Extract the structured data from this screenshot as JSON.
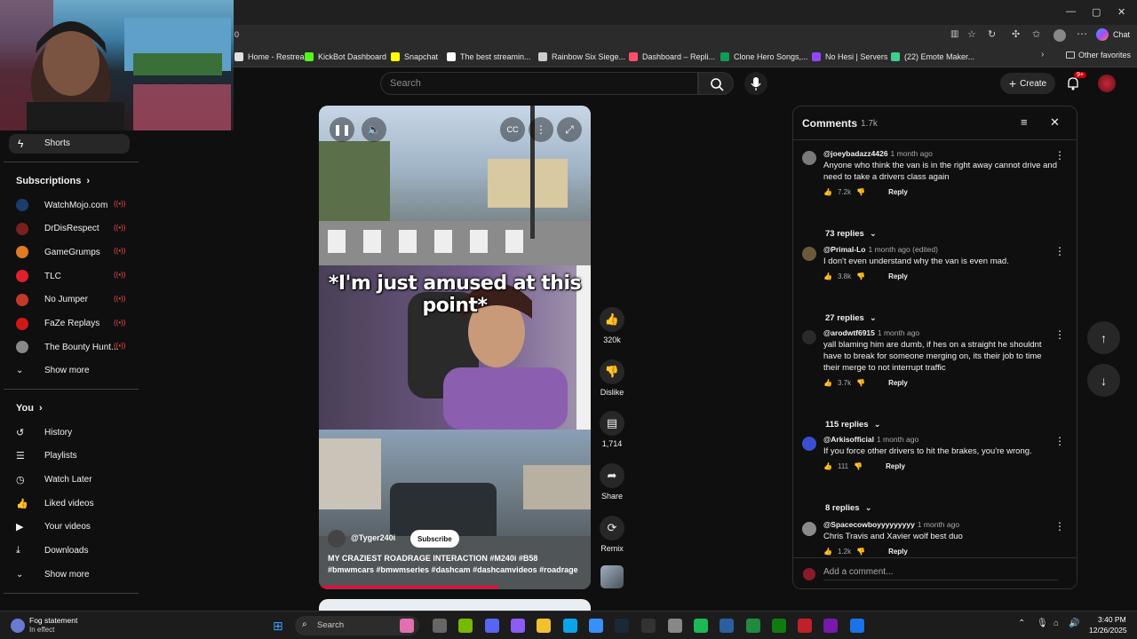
{
  "browser": {
    "address": "0",
    "chat_label": "Chat",
    "other_favorites": "Other favorites",
    "bookmarks": [
      {
        "label": "Home - Restream",
        "color": "#e0e0e0"
      },
      {
        "label": "KickBot Dashboard",
        "color": "#53fc18"
      },
      {
        "label": "Snapchat",
        "color": "#fffc00"
      },
      {
        "label": "The best streamin...",
        "color": "#ffffff"
      },
      {
        "label": "Rainbow Six Siege...",
        "color": "#cccccc"
      },
      {
        "label": "Dashboard – Repli...",
        "color": "#ff4e6a"
      },
      {
        "label": "Clone Hero Songs,...",
        "color": "#0f9d58"
      },
      {
        "label": "No Hesi | Servers",
        "color": "#9146ff"
      },
      {
        "label": "(22) Emote Maker...",
        "color": "#3ecf8e"
      }
    ]
  },
  "header": {
    "search_placeholder": "Search",
    "create_label": "Create",
    "notif_badge": "9+"
  },
  "sidebar": {
    "shorts_label": "Shorts",
    "subscriptions_label": "Subscriptions",
    "channels": [
      {
        "name": "WatchMojo.com",
        "color": "#1a3d6e"
      },
      {
        "name": "DrDisRespect",
        "color": "#7a1f1f"
      },
      {
        "name": "GameGrumps",
        "color": "#e07b20"
      },
      {
        "name": "TLC",
        "color": "#e0202a"
      },
      {
        "name": "No Jumper",
        "color": "#c0392b"
      },
      {
        "name": "FaZe Replays",
        "color": "#d01818"
      },
      {
        "name": "The Bounty Hunt...",
        "color": "#888888"
      }
    ],
    "show_more": "Show more",
    "you_label": "You",
    "you_items": [
      {
        "label": "History",
        "icon": "history-icon"
      },
      {
        "label": "Playlists",
        "icon": "playlists-icon"
      },
      {
        "label": "Watch Later",
        "icon": "watch-later-icon"
      },
      {
        "label": "Liked videos",
        "icon": "liked-icon"
      },
      {
        "label": "Your videos",
        "icon": "your-videos-icon"
      },
      {
        "label": "Downloads",
        "icon": "downloads-icon"
      }
    ],
    "show_more_2": "Show more"
  },
  "video": {
    "caption": "*I'm just amused at this point*",
    "channel": "@Tyger240i",
    "subscribe_label": "Subscribe",
    "title": "MY CRAZIEST ROADRAGE INTERACTION #M240i #B58 #bmwmcars #bmwmseries #dashcam #dashcamvideos #roadrage",
    "progress": 0.66
  },
  "actions": {
    "likes": "320k",
    "dislike": "Dislike",
    "comments": "1,714",
    "share": "Share",
    "remix": "Remix"
  },
  "comments": {
    "title": "Comments",
    "count": "1.7k",
    "add_placeholder": "Add a comment...",
    "reply_label": "Reply",
    "items": [
      {
        "author": "@joeybadazz4426",
        "time": "1 month ago",
        "text": "Anyone who think the van is in the right away cannot drive and need to take a drivers class again",
        "likes": "7.2k",
        "replies": "73 replies",
        "color": "#7a7a7a"
      },
      {
        "author": "@Primal-Lo",
        "time": "1 month ago (edited)",
        "text": "I don't even understand why the van is even mad.",
        "likes": "3.8k",
        "replies": "27 replies",
        "color": "#6b5a3a"
      },
      {
        "author": "@arodwtf6915",
        "time": "1 month ago",
        "text": "yall blaming him are dumb, if hes on a straight he shouldnt have to break for someone merging on, its their job to time their merge to not interrupt traffic",
        "likes": "3.7k",
        "replies": "115 replies",
        "color": "#2a2a2a"
      },
      {
        "author": "@Arkisofficial",
        "time": "1 month ago",
        "text": "If you force other drivers to hit the brakes, you're wrong.",
        "likes": "111",
        "replies": "8 replies",
        "color": "#3a4fd0"
      },
      {
        "author": "@Spacecowboyyyyyyyyy",
        "time": "1 month ago",
        "text": "Chris Travis and Xavier wolf best duo",
        "likes": "1.2k",
        "replies": "",
        "color": "#8a8a8a"
      }
    ]
  },
  "taskbar": {
    "weather_title": "Fog statement",
    "weather_sub": "In effect",
    "search_label": "Search",
    "time": "3:40 PM",
    "date": "12/26/2025"
  }
}
